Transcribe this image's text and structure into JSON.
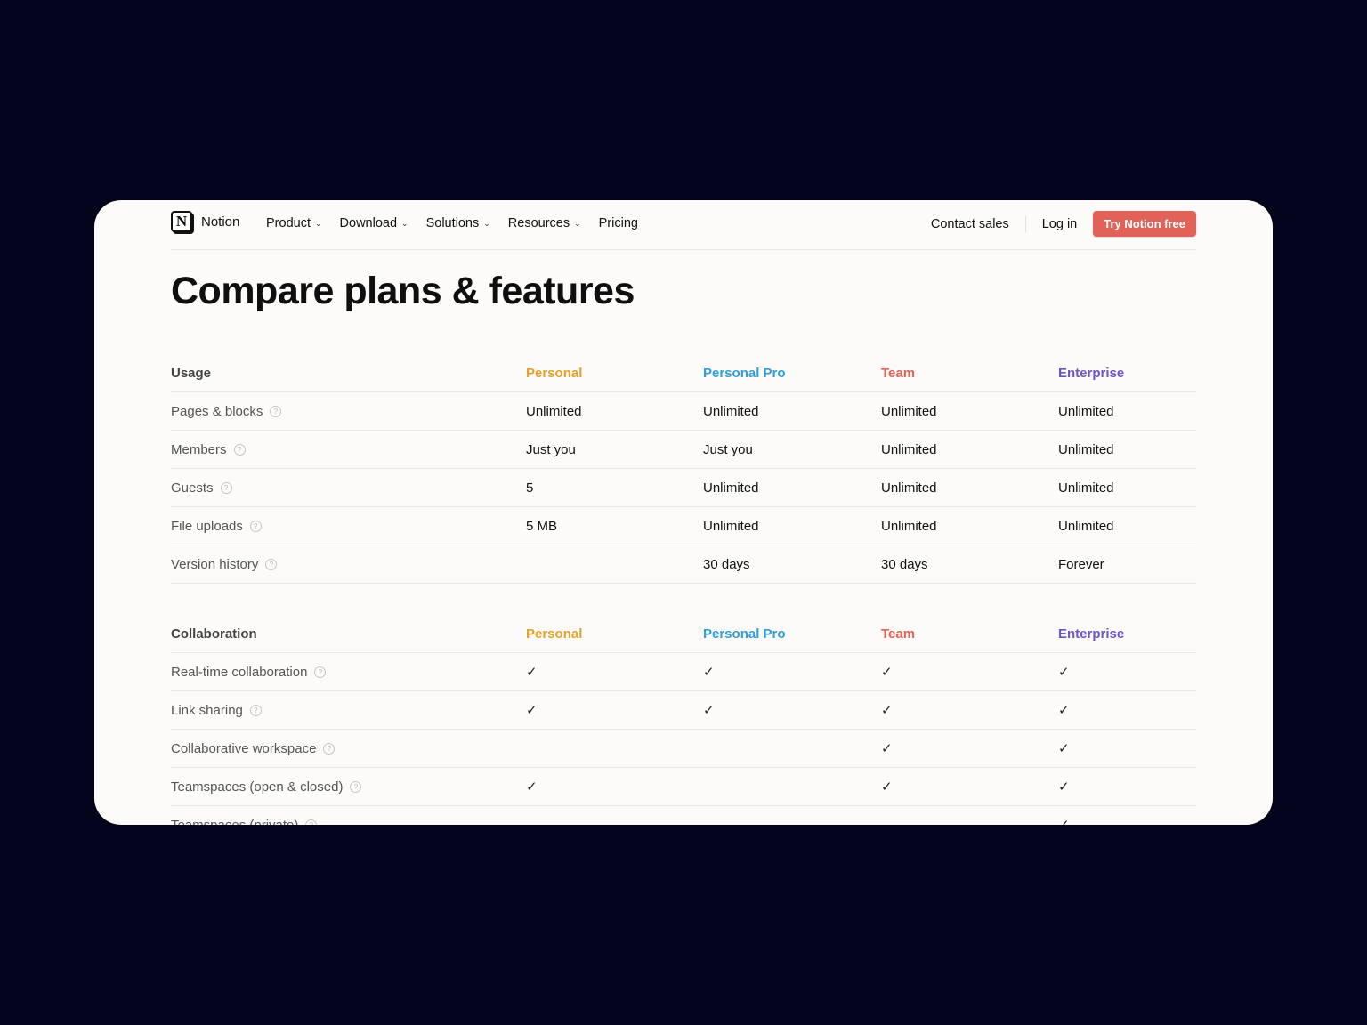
{
  "colors": {
    "personal": "#e5a22b",
    "personal_pro": "#2f9fd8",
    "team": "#e16259",
    "enterprise": "#6f55c4",
    "cta": "#e16259"
  },
  "nav": {
    "logo_glyph": "N",
    "brand": "Notion",
    "links": [
      {
        "label": "Product",
        "has_menu": true
      },
      {
        "label": "Download",
        "has_menu": true
      },
      {
        "label": "Solutions",
        "has_menu": true
      },
      {
        "label": "Resources",
        "has_menu": true
      },
      {
        "label": "Pricing",
        "has_menu": false
      }
    ],
    "contact_sales": "Contact sales",
    "log_in": "Log in",
    "cta": "Try Notion free"
  },
  "page_title": "Compare plans & features",
  "sections": [
    {
      "name": "Usage",
      "plans": [
        "Personal",
        "Personal Pro",
        "Team",
        "Enterprise"
      ],
      "rows": [
        {
          "feature": "Pages & blocks",
          "values": [
            "Unlimited",
            "Unlimited",
            "Unlimited",
            "Unlimited"
          ]
        },
        {
          "feature": "Members",
          "values": [
            "Just you",
            "Just you",
            "Unlimited",
            "Unlimited"
          ]
        },
        {
          "feature": "Guests",
          "values": [
            "5",
            "Unlimited",
            "Unlimited",
            "Unlimited"
          ]
        },
        {
          "feature": "File uploads",
          "values": [
            "5 MB",
            "Unlimited",
            "Unlimited",
            "Unlimited"
          ]
        },
        {
          "feature": "Version history",
          "values": [
            "",
            "30 days",
            "30 days",
            "Forever"
          ]
        }
      ]
    },
    {
      "name": "Collaboration",
      "plans": [
        "Personal",
        "Personal Pro",
        "Team",
        "Enterprise"
      ],
      "rows": [
        {
          "feature": "Real-time collaboration",
          "values": [
            "✓",
            "✓",
            "✓",
            "✓"
          ]
        },
        {
          "feature": "Link sharing",
          "values": [
            "✓",
            "✓",
            "✓",
            "✓"
          ]
        },
        {
          "feature": "Collaborative workspace",
          "values": [
            "",
            "",
            "✓",
            "✓"
          ]
        },
        {
          "feature": "Teamspaces (open & closed)",
          "values": [
            "✓",
            "",
            "✓",
            "✓"
          ]
        },
        {
          "feature": "Teamspaces (private)",
          "values": [
            "",
            "",
            "",
            "✓"
          ]
        }
      ]
    }
  ],
  "help_icon_glyph": "?",
  "chevron_glyph": "⌄"
}
